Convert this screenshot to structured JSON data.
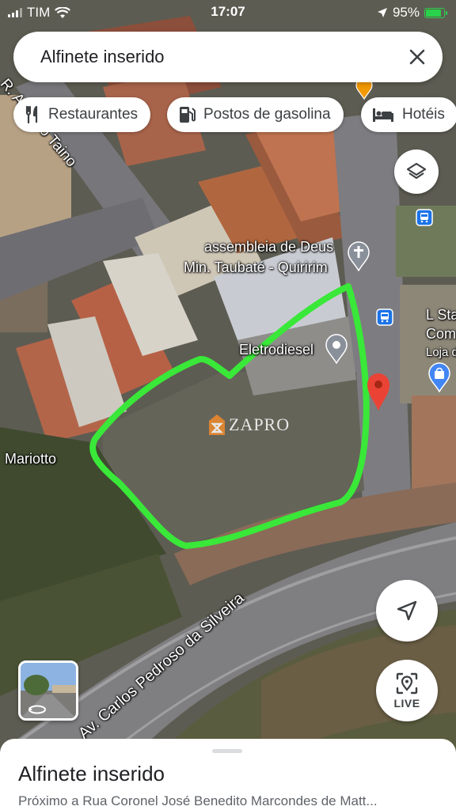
{
  "status_bar": {
    "carrier": "TIM",
    "time": "17:07",
    "battery_percent": "95%"
  },
  "search": {
    "title": "Alfinete inserido"
  },
  "chips": [
    {
      "label": "Restaurantes",
      "icon": "fork-knife-icon"
    },
    {
      "label": "Postos de gasolina",
      "icon": "gas-station-icon"
    },
    {
      "label": "Hotéis",
      "icon": "bed-icon"
    }
  ],
  "map": {
    "labels": {
      "street_top": "R. Antônio Taino",
      "poi_church_line1": "assembleia de Deus",
      "poi_church_line2": "Min. Taubaté - Quiririm",
      "poi_eletrodiesel": "Eletrodiesel",
      "poi_store_line1": "L Sta",
      "poi_store_line2": "Com",
      "poi_store_line3": "Loja d",
      "street_left": "Mariotto",
      "avenue": "Av. Carlos Pedroso da Silveira",
      "watermark": "ZAPRO"
    },
    "colors": {
      "outline": "#39e838",
      "pin": "#ea4335",
      "bus_stop": "#1a73e8",
      "poi_gray": "#8a9099"
    }
  },
  "controls": {
    "layers_icon": "layers-icon",
    "location_icon": "navigation-arrow-icon",
    "live_label": "LIVE"
  },
  "sheet": {
    "title": "Alfinete inserido",
    "subtitle": "Próximo a Rua Coronel José Benedito Marcondes de Matt..."
  }
}
